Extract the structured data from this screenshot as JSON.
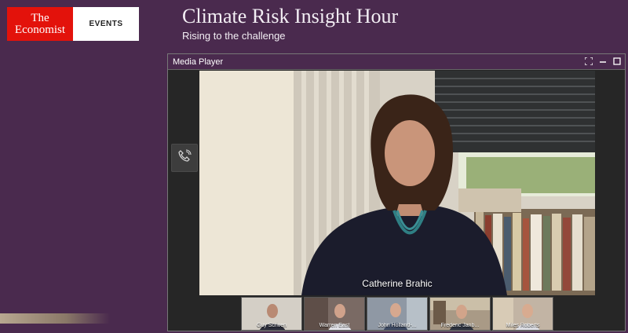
{
  "branding": {
    "logo_line1": "The",
    "logo_line2": "Economist",
    "logo_events": "EVENTS"
  },
  "event": {
    "title": "Climate Risk Insight Hour",
    "subtitle": "Rising to the challenge"
  },
  "player": {
    "title": "Media Player",
    "controls": [
      "fullscreen-icon",
      "minimize-icon",
      "maximize-icon"
    ],
    "speaker_name": "Catherine Brahic",
    "participants": [
      {
        "name": "Guy Scriven"
      },
      {
        "name": "Warren East"
      },
      {
        "name": "John Holland-..."
      },
      {
        "name": "Frederic Janb..."
      },
      {
        "name": "Miles Roberts"
      }
    ]
  },
  "colors": {
    "background": "#4a2a4e",
    "brand_red": "#e3120b"
  }
}
